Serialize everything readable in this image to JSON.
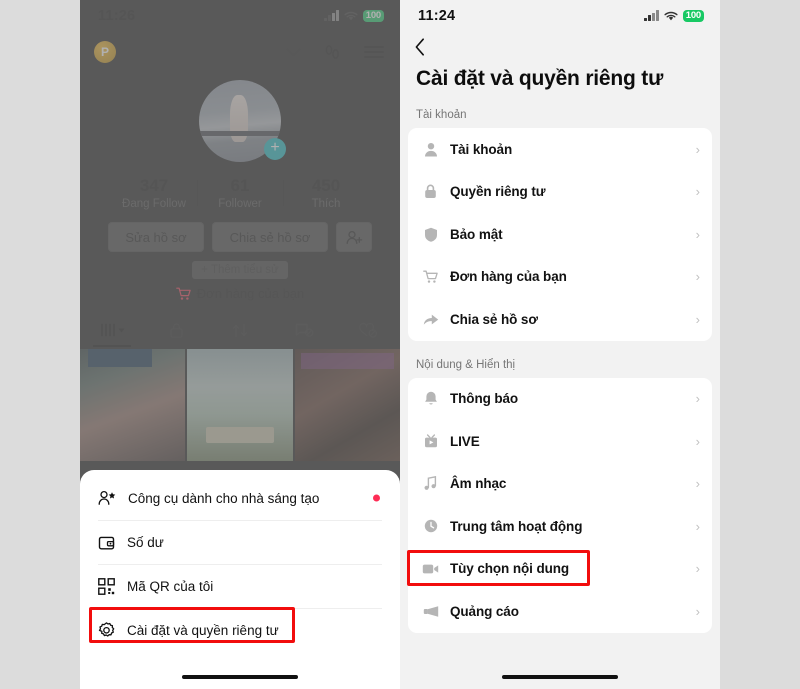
{
  "left_phone": {
    "status_bar": {
      "time": "11:26",
      "battery": "100",
      "signal_icon": "cellular-signal-icon",
      "wifi_icon": "wifi-icon",
      "battery_icon": "battery-icon"
    },
    "header": {
      "badge_letter": "P",
      "chevron_icon": "chevron-down-icon",
      "footprints_icon": "footprints-icon",
      "menu_icon": "hamburger-menu-icon"
    },
    "profile": {
      "avatar_icon": "profile-avatar",
      "add_icon": "add-plus-icon",
      "stats": [
        {
          "value": "347",
          "label": "Đang Follow"
        },
        {
          "value": "61",
          "label": "Follower"
        },
        {
          "value": "450",
          "label": "Thích"
        }
      ],
      "buttons": [
        {
          "label": "Sửa hồ sơ",
          "icon": ""
        },
        {
          "label": "Chia sẻ hồ sơ",
          "icon": ""
        },
        {
          "label": "",
          "icon": "add-friend-icon"
        }
      ],
      "bio_chip": "+ Thêm tiểu sử",
      "order_row": {
        "icon": "shopping-cart-icon",
        "label": "Đơn hàng của bạn"
      }
    },
    "tabs": [
      {
        "name": "posts-tab",
        "icon": "grid-icon",
        "active": true
      },
      {
        "name": "private-tab",
        "icon": "lock-icon",
        "active": false
      },
      {
        "name": "reposts-tab",
        "icon": "repost-icon",
        "active": false
      },
      {
        "name": "hidden-videos-tab",
        "icon": "hidden-video-icon",
        "active": false
      },
      {
        "name": "liked-tab",
        "icon": "hidden-heart-icon",
        "active": false
      }
    ],
    "grid": [
      {
        "name": "post-thumbnail-1"
      },
      {
        "name": "post-thumbnail-2"
      },
      {
        "name": "post-thumbnail-3"
      }
    ],
    "bottom_sheet": {
      "items": [
        {
          "icon": "creator-tools-icon",
          "label": "Công cụ dành cho nhà sáng tạo",
          "badge": true,
          "highlighted": false
        },
        {
          "icon": "wallet-icon",
          "label": "Số dư",
          "badge": false,
          "highlighted": false
        },
        {
          "icon": "qr-code-icon",
          "label": "Mã QR của tôi",
          "badge": false,
          "highlighted": false
        },
        {
          "icon": "gear-icon",
          "label": "Cài đặt và quyền riêng tư",
          "badge": false,
          "highlighted": true
        }
      ]
    }
  },
  "right_phone": {
    "status_bar": {
      "time": "11:24",
      "battery": "100",
      "signal_icon": "cellular-signal-icon",
      "wifi_icon": "wifi-icon",
      "battery_icon": "battery-icon"
    },
    "back_icon": "back-chevron-icon",
    "title": "Cài đặt và quyền riêng tư",
    "sections": [
      {
        "label": "Tài khoản",
        "rows": [
          {
            "icon": "person-icon",
            "label": "Tài khoản",
            "chevron": "›",
            "highlighted": false
          },
          {
            "icon": "lock-icon",
            "label": "Quyền riêng tư",
            "chevron": "›",
            "highlighted": false
          },
          {
            "icon": "shield-icon",
            "label": "Bảo mật",
            "chevron": "›",
            "highlighted": false
          },
          {
            "icon": "shopping-cart-icon",
            "label": "Đơn hàng của bạn",
            "chevron": "›",
            "highlighted": false
          },
          {
            "icon": "share-arrow-icon",
            "label": "Chia sẻ hồ sơ",
            "chevron": "›",
            "highlighted": false
          }
        ]
      },
      {
        "label": "Nội dung & Hiển thị",
        "rows": [
          {
            "icon": "bell-icon",
            "label": "Thông báo",
            "chevron": "›",
            "highlighted": false
          },
          {
            "icon": "live-icon",
            "label": "LIVE",
            "chevron": "›",
            "highlighted": false
          },
          {
            "icon": "music-note-icon",
            "label": "Âm nhạc",
            "chevron": "›",
            "highlighted": false
          },
          {
            "icon": "clock-icon",
            "label": "Trung tâm hoạt động",
            "chevron": "›",
            "highlighted": true
          },
          {
            "icon": "video-camera-icon",
            "label": "Tùy chọn nội dung",
            "chevron": "›",
            "highlighted": false
          },
          {
            "icon": "megaphone-icon",
            "label": "Quảng cáo",
            "chevron": "›",
            "highlighted": false
          }
        ]
      }
    ]
  },
  "colors": {
    "background": "#dcdcdc",
    "highlight_red": "#f20d0d",
    "accent_teal": "#18b8c0",
    "badge_red": "#fe2c55",
    "battery_green": "#18c964",
    "card_white": "#ffffff",
    "panel_gray": "#f2f2f2"
  }
}
